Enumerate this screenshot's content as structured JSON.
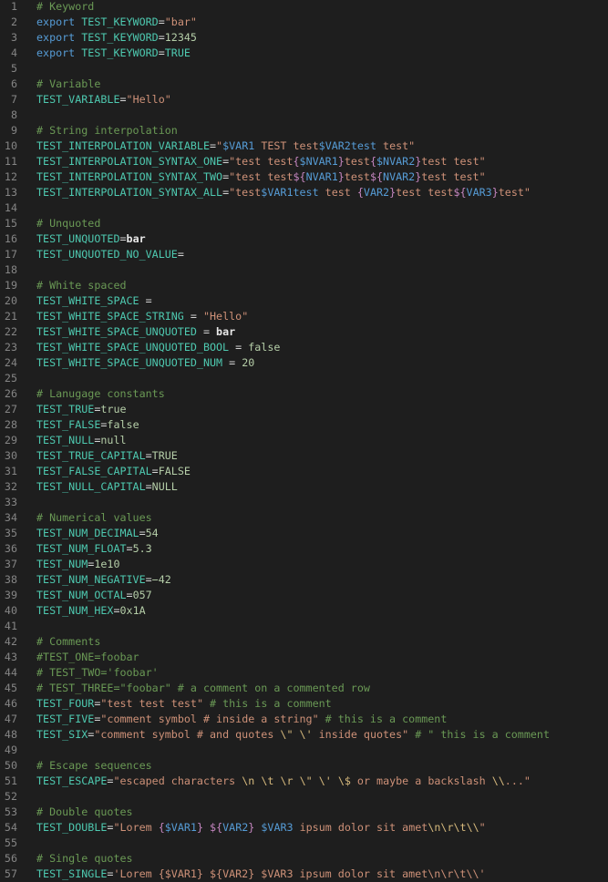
{
  "editor": {
    "language": "dotenv",
    "colors": {
      "background": "#1e1e1e",
      "line_number": "#858585",
      "comment": "#6a9955",
      "variable": "#4ec9b0",
      "keyword": "#569cd6",
      "string": "#ce9178",
      "number": "#b5cea8",
      "operator": "#d4d4d4",
      "escape": "#d7ba7d"
    },
    "lines": [
      {
        "n": "1",
        "tokens": [
          {
            "t": "# Keyword",
            "c": "cmt"
          }
        ]
      },
      {
        "n": "2",
        "tokens": [
          {
            "t": "export ",
            "c": "kw"
          },
          {
            "t": "TEST_KEYWORD",
            "c": "var"
          },
          {
            "t": "=",
            "c": "op"
          },
          {
            "t": "\"bar\"",
            "c": "str"
          }
        ]
      },
      {
        "n": "3",
        "tokens": [
          {
            "t": "export ",
            "c": "kw"
          },
          {
            "t": "TEST_KEYWORD",
            "c": "var"
          },
          {
            "t": "=",
            "c": "op"
          },
          {
            "t": "12345",
            "c": "num"
          }
        ]
      },
      {
        "n": "4",
        "tokens": [
          {
            "t": "export ",
            "c": "kw"
          },
          {
            "t": "TEST_KEYWORD",
            "c": "var"
          },
          {
            "t": "=",
            "c": "op"
          },
          {
            "t": "TRUE",
            "c": "var"
          }
        ]
      },
      {
        "n": "5",
        "tokens": []
      },
      {
        "n": "6",
        "tokens": [
          {
            "t": "# Variable",
            "c": "cmt"
          }
        ]
      },
      {
        "n": "7",
        "tokens": [
          {
            "t": "TEST_VARIABLE",
            "c": "var"
          },
          {
            "t": "=",
            "c": "op"
          },
          {
            "t": "\"Hello\"",
            "c": "str"
          }
        ]
      },
      {
        "n": "8",
        "tokens": []
      },
      {
        "n": "9",
        "tokens": [
          {
            "t": "# String interpolation",
            "c": "cmt"
          }
        ]
      },
      {
        "n": "10",
        "tokens": [
          {
            "t": "TEST_INTERPOLATION_VARIABLE",
            "c": "var"
          },
          {
            "t": "=",
            "c": "op"
          },
          {
            "t": "\"",
            "c": "str"
          },
          {
            "t": "$VAR1",
            "c": "interp"
          },
          {
            "t": " TEST test",
            "c": "str"
          },
          {
            "t": "$VAR2test",
            "c": "interp"
          },
          {
            "t": " test\"",
            "c": "str"
          }
        ]
      },
      {
        "n": "11",
        "tokens": [
          {
            "t": "TEST_INTERPOLATION_SYNTAX_ONE",
            "c": "var"
          },
          {
            "t": "=",
            "c": "op"
          },
          {
            "t": "\"test test",
            "c": "str"
          },
          {
            "t": "{",
            "c": "brace"
          },
          {
            "t": "$NVAR1",
            "c": "interp"
          },
          {
            "t": "}",
            "c": "brace"
          },
          {
            "t": "test",
            "c": "str"
          },
          {
            "t": "{",
            "c": "brace"
          },
          {
            "t": "$NVAR2",
            "c": "interp"
          },
          {
            "t": "}",
            "c": "brace"
          },
          {
            "t": "test test\"",
            "c": "str"
          }
        ]
      },
      {
        "n": "12",
        "tokens": [
          {
            "t": "TEST_INTERPOLATION_SYNTAX_TWO",
            "c": "var"
          },
          {
            "t": "=",
            "c": "op"
          },
          {
            "t": "\"test test",
            "c": "str"
          },
          {
            "t": "${",
            "c": "brace"
          },
          {
            "t": "NVAR1",
            "c": "interp"
          },
          {
            "t": "}",
            "c": "brace"
          },
          {
            "t": "test",
            "c": "str"
          },
          {
            "t": "${",
            "c": "brace"
          },
          {
            "t": "NVAR2",
            "c": "interp"
          },
          {
            "t": "}",
            "c": "brace"
          },
          {
            "t": "test test\"",
            "c": "str"
          }
        ]
      },
      {
        "n": "13",
        "tokens": [
          {
            "t": "TEST_INTERPOLATION_SYNTAX_ALL",
            "c": "var"
          },
          {
            "t": "=",
            "c": "op"
          },
          {
            "t": "\"test",
            "c": "str"
          },
          {
            "t": "$VAR1test",
            "c": "interp"
          },
          {
            "t": " test ",
            "c": "str"
          },
          {
            "t": "{",
            "c": "brace"
          },
          {
            "t": "VAR2",
            "c": "interp"
          },
          {
            "t": "}",
            "c": "brace"
          },
          {
            "t": "test test",
            "c": "str"
          },
          {
            "t": "${",
            "c": "brace"
          },
          {
            "t": "VAR3",
            "c": "interp"
          },
          {
            "t": "}",
            "c": "brace"
          },
          {
            "t": "test\"",
            "c": "str"
          }
        ]
      },
      {
        "n": "14",
        "tokens": []
      },
      {
        "n": "15",
        "tokens": [
          {
            "t": "# Unquoted",
            "c": "cmt"
          }
        ]
      },
      {
        "n": "16",
        "tokens": [
          {
            "t": "TEST_UNQUOTED",
            "c": "var"
          },
          {
            "t": "=",
            "c": "op"
          },
          {
            "t": "bar",
            "c": "plain"
          }
        ]
      },
      {
        "n": "17",
        "tokens": [
          {
            "t": "TEST_UNQUOTED_NO_VALUE",
            "c": "var"
          },
          {
            "t": "=",
            "c": "op"
          }
        ]
      },
      {
        "n": "18",
        "tokens": []
      },
      {
        "n": "19",
        "tokens": [
          {
            "t": "# White spaced",
            "c": "cmt"
          }
        ]
      },
      {
        "n": "20",
        "tokens": [
          {
            "t": "TEST_WHITE_SPACE",
            "c": "var"
          },
          {
            "t": " =",
            "c": "op"
          }
        ]
      },
      {
        "n": "21",
        "tokens": [
          {
            "t": "TEST_WHITE_SPACE_STRING",
            "c": "var"
          },
          {
            "t": " = ",
            "c": "op"
          },
          {
            "t": "\"Hello\"",
            "c": "str"
          }
        ]
      },
      {
        "n": "22",
        "tokens": [
          {
            "t": "TEST_WHITE_SPACE_UNQUOTED",
            "c": "var"
          },
          {
            "t": " = ",
            "c": "op"
          },
          {
            "t": "bar",
            "c": "plain"
          }
        ]
      },
      {
        "n": "23",
        "tokens": [
          {
            "t": "TEST_WHITE_SPACE_UNQUOTED_BOOL",
            "c": "var"
          },
          {
            "t": " = ",
            "c": "op"
          },
          {
            "t": "false",
            "c": "num"
          }
        ]
      },
      {
        "n": "24",
        "tokens": [
          {
            "t": "TEST_WHITE_SPACE_UNQUOTED_NUM",
            "c": "var"
          },
          {
            "t": " = ",
            "c": "op"
          },
          {
            "t": "20",
            "c": "num"
          }
        ]
      },
      {
        "n": "25",
        "tokens": []
      },
      {
        "n": "26",
        "tokens": [
          {
            "t": "# Lanugage constants",
            "c": "cmt"
          }
        ]
      },
      {
        "n": "27",
        "tokens": [
          {
            "t": "TEST_TRUE",
            "c": "var"
          },
          {
            "t": "=",
            "c": "op"
          },
          {
            "t": "true",
            "c": "num"
          }
        ]
      },
      {
        "n": "28",
        "tokens": [
          {
            "t": "TEST_FALSE",
            "c": "var"
          },
          {
            "t": "=",
            "c": "op"
          },
          {
            "t": "false",
            "c": "num"
          }
        ]
      },
      {
        "n": "29",
        "tokens": [
          {
            "t": "TEST_NULL",
            "c": "var"
          },
          {
            "t": "=",
            "c": "op"
          },
          {
            "t": "null",
            "c": "num"
          }
        ]
      },
      {
        "n": "30",
        "tokens": [
          {
            "t": "TEST_TRUE_CAPITAL",
            "c": "var"
          },
          {
            "t": "=",
            "c": "op"
          },
          {
            "t": "TRUE",
            "c": "num"
          }
        ]
      },
      {
        "n": "31",
        "tokens": [
          {
            "t": "TEST_FALSE_CAPITAL",
            "c": "var"
          },
          {
            "t": "=",
            "c": "op"
          },
          {
            "t": "FALSE",
            "c": "num"
          }
        ]
      },
      {
        "n": "32",
        "tokens": [
          {
            "t": "TEST_NULL_CAPITAL",
            "c": "var"
          },
          {
            "t": "=",
            "c": "op"
          },
          {
            "t": "NULL",
            "c": "num"
          }
        ]
      },
      {
        "n": "33",
        "tokens": []
      },
      {
        "n": "34",
        "tokens": [
          {
            "t": "# Numerical values",
            "c": "cmt"
          }
        ]
      },
      {
        "n": "35",
        "tokens": [
          {
            "t": "TEST_NUM_DECIMAL",
            "c": "var"
          },
          {
            "t": "=",
            "c": "op"
          },
          {
            "t": "54",
            "c": "num"
          }
        ]
      },
      {
        "n": "36",
        "tokens": [
          {
            "t": "TEST_NUM_FLOAT",
            "c": "var"
          },
          {
            "t": "=",
            "c": "op"
          },
          {
            "t": "5.3",
            "c": "num"
          }
        ]
      },
      {
        "n": "37",
        "tokens": [
          {
            "t": "TEST_NUM",
            "c": "var"
          },
          {
            "t": "=",
            "c": "op"
          },
          {
            "t": "1e10",
            "c": "num"
          }
        ]
      },
      {
        "n": "38",
        "tokens": [
          {
            "t": "TEST_NUM_NEGATIVE",
            "c": "var"
          },
          {
            "t": "=",
            "c": "op"
          },
          {
            "t": "−42",
            "c": "num"
          }
        ]
      },
      {
        "n": "39",
        "tokens": [
          {
            "t": "TEST_NUM_OCTAL",
            "c": "var"
          },
          {
            "t": "=",
            "c": "op"
          },
          {
            "t": "057",
            "c": "num"
          }
        ]
      },
      {
        "n": "40",
        "tokens": [
          {
            "t": "TEST_NUM_HEX",
            "c": "var"
          },
          {
            "t": "=",
            "c": "op"
          },
          {
            "t": "0x1A",
            "c": "num"
          }
        ]
      },
      {
        "n": "41",
        "tokens": []
      },
      {
        "n": "42",
        "tokens": [
          {
            "t": "# Comments",
            "c": "cmt"
          }
        ]
      },
      {
        "n": "43",
        "tokens": [
          {
            "t": "#TEST_ONE=foobar",
            "c": "cmt"
          }
        ]
      },
      {
        "n": "44",
        "tokens": [
          {
            "t": "# TEST_TWO='foobar'",
            "c": "cmt"
          }
        ]
      },
      {
        "n": "45",
        "tokens": [
          {
            "t": "# TEST_THREE=\"foobar\" # a comment on a commented row",
            "c": "cmt"
          }
        ]
      },
      {
        "n": "46",
        "tokens": [
          {
            "t": "TEST_FOUR",
            "c": "var"
          },
          {
            "t": "=",
            "c": "op"
          },
          {
            "t": "\"test test test\"",
            "c": "str"
          },
          {
            "t": " # this is a comment",
            "c": "cmt"
          }
        ]
      },
      {
        "n": "47",
        "tokens": [
          {
            "t": "TEST_FIVE",
            "c": "var"
          },
          {
            "t": "=",
            "c": "op"
          },
          {
            "t": "\"comment symbol # inside a string\"",
            "c": "str"
          },
          {
            "t": " # this is a comment",
            "c": "cmt"
          }
        ]
      },
      {
        "n": "48",
        "tokens": [
          {
            "t": "TEST_SIX",
            "c": "var"
          },
          {
            "t": "=",
            "c": "op"
          },
          {
            "t": "\"comment symbol # and quotes ",
            "c": "str"
          },
          {
            "t": "\\\"",
            "c": "esc"
          },
          {
            "t": " ",
            "c": "str"
          },
          {
            "t": "\\'",
            "c": "esc"
          },
          {
            "t": " inside quotes\"",
            "c": "str"
          },
          {
            "t": " # \" this is a comment",
            "c": "cmt"
          }
        ]
      },
      {
        "n": "49",
        "tokens": []
      },
      {
        "n": "50",
        "tokens": [
          {
            "t": "# Escape sequences",
            "c": "cmt"
          }
        ]
      },
      {
        "n": "51",
        "tokens": [
          {
            "t": "TEST_ESCAPE",
            "c": "var"
          },
          {
            "t": "=",
            "c": "op"
          },
          {
            "t": "\"escaped characters ",
            "c": "str"
          },
          {
            "t": "\\n",
            "c": "esc"
          },
          {
            "t": " ",
            "c": "str"
          },
          {
            "t": "\\t",
            "c": "esc"
          },
          {
            "t": " ",
            "c": "str"
          },
          {
            "t": "\\r",
            "c": "esc"
          },
          {
            "t": " ",
            "c": "str"
          },
          {
            "t": "\\\"",
            "c": "esc"
          },
          {
            "t": " ",
            "c": "str"
          },
          {
            "t": "\\'",
            "c": "esc"
          },
          {
            "t": " ",
            "c": "str"
          },
          {
            "t": "\\$",
            "c": "esc"
          },
          {
            "t": " or maybe a backslash ",
            "c": "str"
          },
          {
            "t": "\\\\",
            "c": "esc"
          },
          {
            "t": "...\"",
            "c": "str"
          }
        ]
      },
      {
        "n": "52",
        "tokens": []
      },
      {
        "n": "53",
        "tokens": [
          {
            "t": "# Double quotes",
            "c": "cmt"
          }
        ]
      },
      {
        "n": "54",
        "tokens": [
          {
            "t": "TEST_DOUBLE",
            "c": "var"
          },
          {
            "t": "=",
            "c": "op"
          },
          {
            "t": "\"Lorem ",
            "c": "str"
          },
          {
            "t": "{",
            "c": "brace"
          },
          {
            "t": "$VAR1",
            "c": "interp"
          },
          {
            "t": "}",
            "c": "brace"
          },
          {
            "t": " ",
            "c": "str"
          },
          {
            "t": "${",
            "c": "brace"
          },
          {
            "t": "VAR2",
            "c": "interp"
          },
          {
            "t": "}",
            "c": "brace"
          },
          {
            "t": " ",
            "c": "str"
          },
          {
            "t": "$VAR3",
            "c": "interp"
          },
          {
            "t": " ipsum dolor sit amet",
            "c": "str"
          },
          {
            "t": "\\n\\r\\t\\\\",
            "c": "esc"
          },
          {
            "t": "\"",
            "c": "str"
          }
        ]
      },
      {
        "n": "55",
        "tokens": []
      },
      {
        "n": "56",
        "tokens": [
          {
            "t": "# Single quotes",
            "c": "cmt"
          }
        ]
      },
      {
        "n": "57",
        "tokens": [
          {
            "t": "TEST_SINGLE",
            "c": "var"
          },
          {
            "t": "=",
            "c": "op"
          },
          {
            "t": "'Lorem {$VAR1} ${VAR2} $VAR3 ipsum dolor sit amet\\n\\r\\t\\\\'",
            "c": "str"
          }
        ]
      }
    ]
  }
}
